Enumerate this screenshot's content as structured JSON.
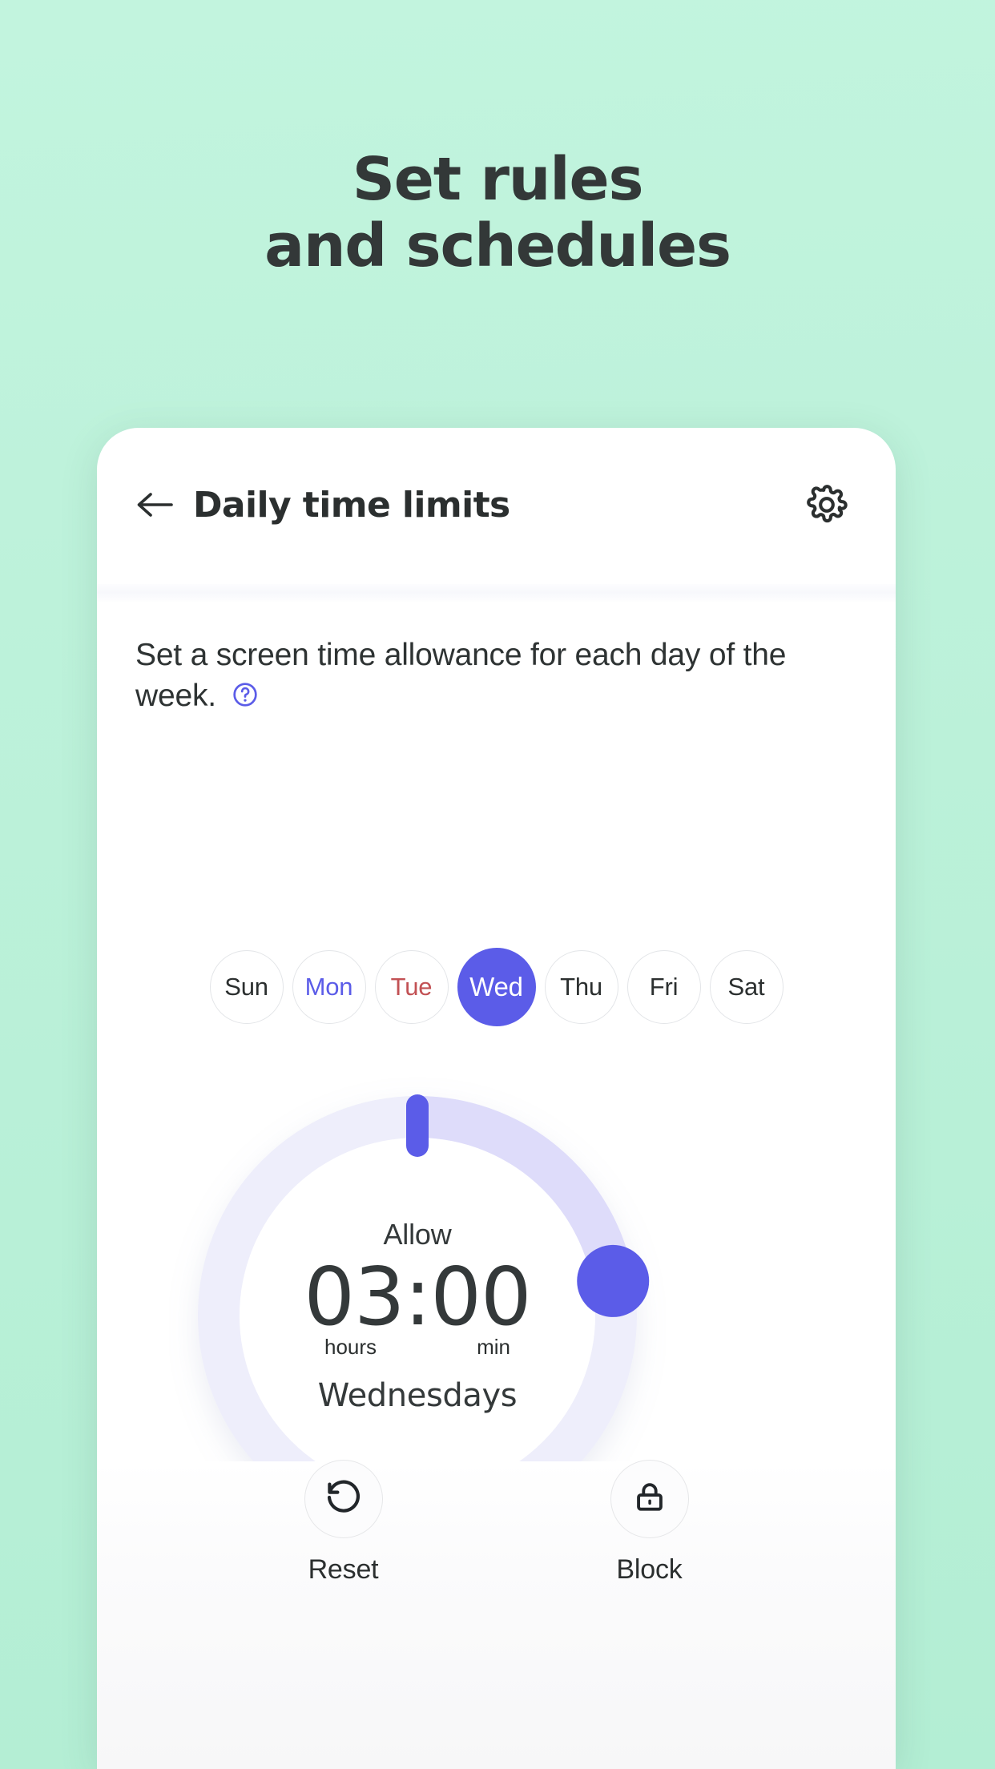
{
  "promo": {
    "line1": "Set rules",
    "line2": "and schedules"
  },
  "app": {
    "header": {
      "back_icon": "arrow-left-icon",
      "title": "Daily time limits",
      "settings_icon": "gear-icon"
    },
    "description": {
      "text": "Set a screen time allowance for each day of the week.",
      "help_icon": "question-circle-icon"
    },
    "days": [
      {
        "label": "Sun",
        "state": "normal"
      },
      {
        "label": "Mon",
        "state": "accent"
      },
      {
        "label": "Tue",
        "state": "warn"
      },
      {
        "label": "Wed",
        "state": "selected"
      },
      {
        "label": "Thu",
        "state": "normal"
      },
      {
        "label": "Fri",
        "state": "normal"
      },
      {
        "label": "Sat",
        "state": "normal"
      }
    ],
    "dial": {
      "allow_label": "Allow",
      "time": "03:00",
      "hours_unit": "hours",
      "minutes_unit": "min",
      "day_name": "Wednesdays",
      "progress_degrees": 80,
      "track_color": "#eeeefb",
      "progress_color": "#dedcfa",
      "thumb_color": "#5b5ce8",
      "start_marker_color": "#5b5ce8"
    },
    "actions": [
      {
        "label": "Reset",
        "icon": "rotate-ccw-icon"
      },
      {
        "label": "Block",
        "icon": "lock-icon"
      }
    ]
  },
  "theme": {
    "background": "#bdf3dc",
    "accent": "#5b5ce8",
    "warn": "#c25154",
    "text": "#2b2f2f",
    "card": "#ffffff"
  }
}
